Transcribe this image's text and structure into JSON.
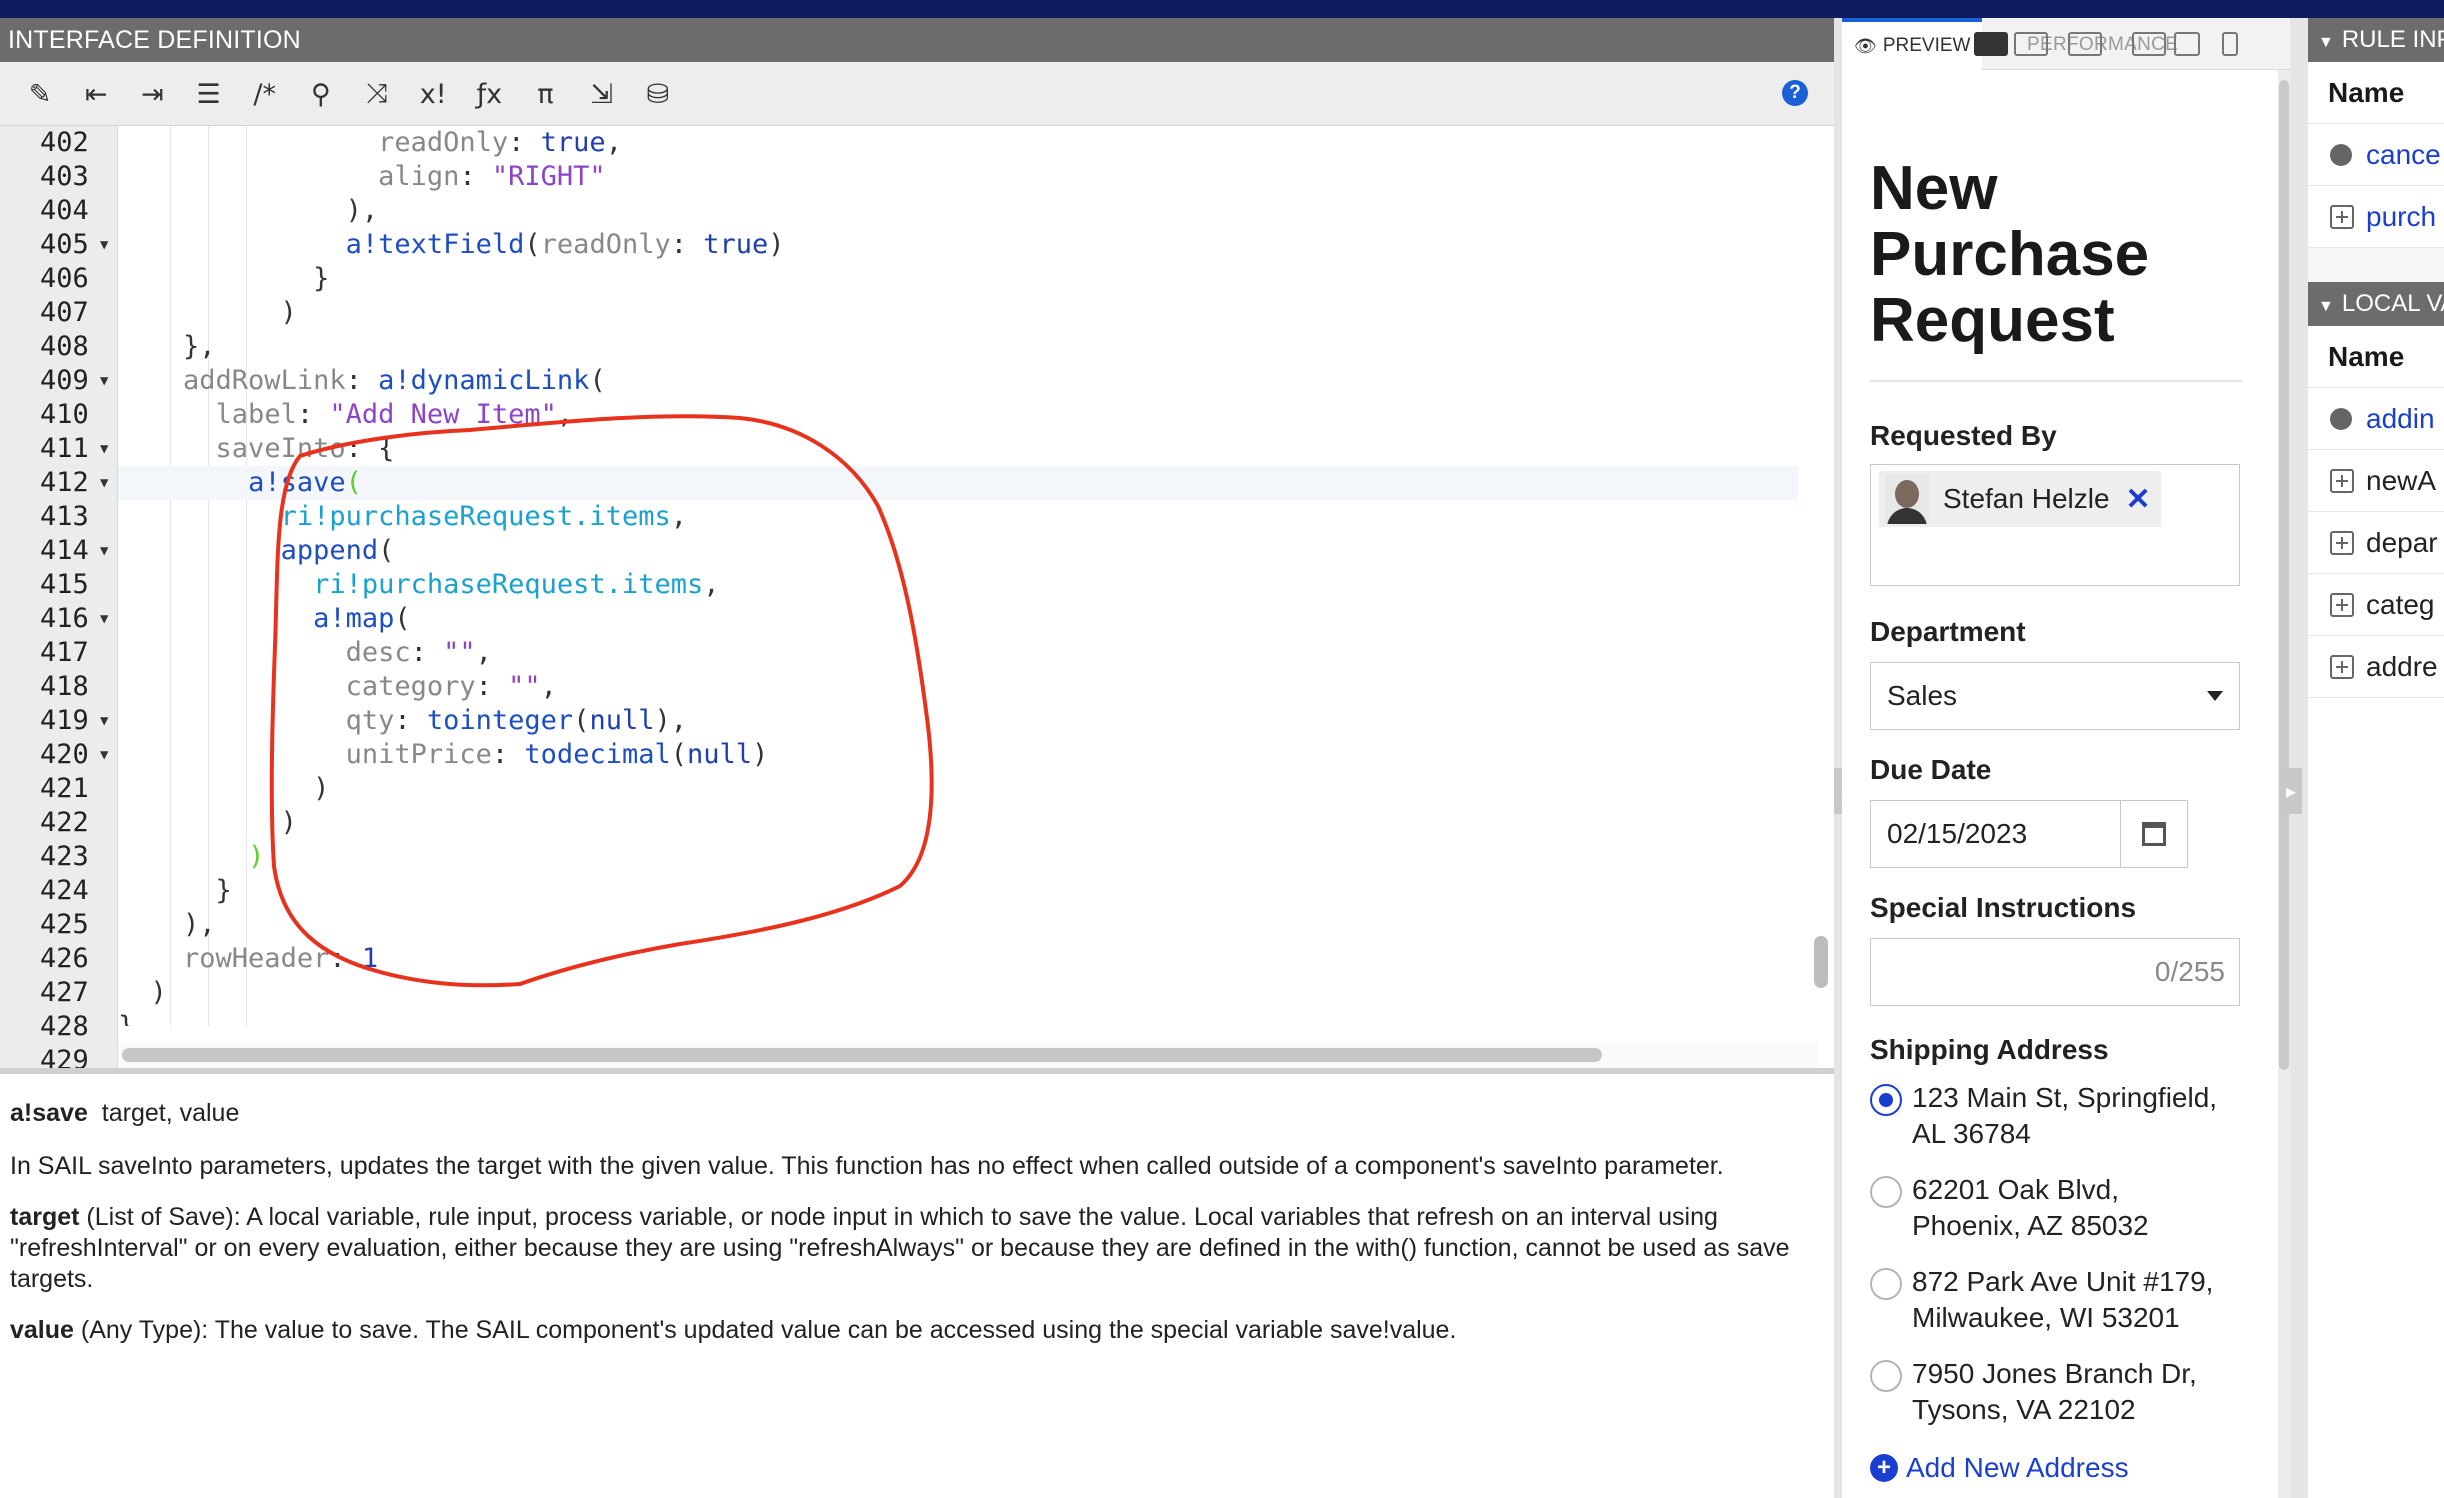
{
  "editor": {
    "title": "INTERFACE DEFINITION",
    "line_numbers": [
      "402",
      "403",
      "404",
      "405",
      "406",
      "407",
      "408",
      "409",
      "410",
      "411",
      "412",
      "413",
      "414",
      "415",
      "416",
      "417",
      "418",
      "419",
      "420",
      "421",
      "422",
      "423",
      "424",
      "425",
      "426",
      "427",
      "428",
      "429"
    ],
    "folded_lines": [
      "405",
      "409",
      "411",
      "412",
      "414",
      "416",
      "419",
      "420"
    ],
    "code_lines": [
      [
        {
          "t": "        "
        },
        {
          "t": "readOnly",
          "c": "k"
        },
        {
          "t": ": "
        },
        {
          "t": "true",
          "c": "v"
        },
        {
          "t": ","
        }
      ],
      [
        {
          "t": "        "
        },
        {
          "t": "align",
          "c": "k"
        },
        {
          "t": ": "
        },
        {
          "t": "\"RIGHT\"",
          "c": "s"
        }
      ],
      [
        {
          "t": "      ),"
        }
      ],
      [
        {
          "t": "      "
        },
        {
          "t": "a!textField",
          "c": "f"
        },
        {
          "t": "("
        },
        {
          "t": "readOnly",
          "c": "k"
        },
        {
          "t": ": "
        },
        {
          "t": "true",
          "c": "v"
        },
        {
          "t": ")"
        }
      ],
      [
        {
          "t": "    }"
        }
      ],
      [
        {
          "t": "  )"
        }
      ],
      [
        {
          "t": "},"
        }
      ],
      [
        {
          "t": "addRowLink",
          "c": "k"
        },
        {
          "t": ": "
        },
        {
          "t": "a!dynamicLink",
          "c": "f"
        },
        {
          "t": "("
        }
      ],
      [
        {
          "t": "  "
        },
        {
          "t": "label",
          "c": "k"
        },
        {
          "t": ": "
        },
        {
          "t": "\"Add New Item\"",
          "c": "s"
        },
        {
          "t": ","
        }
      ],
      [
        {
          "t": "  "
        },
        {
          "t": "saveInto",
          "c": "k"
        },
        {
          "t": ": {"
        }
      ],
      [
        {
          "t": "    "
        },
        {
          "t": "a!save",
          "c": "f"
        },
        {
          "t": "(",
          "c": "br"
        }
      ],
      [
        {
          "t": "      "
        },
        {
          "t": "ri!purchaseRequest.items",
          "c": "ri"
        },
        {
          "t": ","
        }
      ],
      [
        {
          "t": "      "
        },
        {
          "t": "append",
          "c": "f"
        },
        {
          "t": "("
        }
      ],
      [
        {
          "t": "        "
        },
        {
          "t": "ri!purchaseRequest.items",
          "c": "ri"
        },
        {
          "t": ","
        }
      ],
      [
        {
          "t": "        "
        },
        {
          "t": "a!map",
          "c": "f"
        },
        {
          "t": "("
        }
      ],
      [
        {
          "t": "          "
        },
        {
          "t": "desc",
          "c": "k"
        },
        {
          "t": ": "
        },
        {
          "t": "\"\"",
          "c": "s"
        },
        {
          "t": ","
        }
      ],
      [
        {
          "t": "          "
        },
        {
          "t": "category",
          "c": "k"
        },
        {
          "t": ": "
        },
        {
          "t": "\"\"",
          "c": "s"
        },
        {
          "t": ","
        }
      ],
      [
        {
          "t": "          "
        },
        {
          "t": "qty",
          "c": "k"
        },
        {
          "t": ": "
        },
        {
          "t": "tointeger",
          "c": "f"
        },
        {
          "t": "("
        },
        {
          "t": "null",
          "c": "v"
        },
        {
          "t": "),"
        }
      ],
      [
        {
          "t": "          "
        },
        {
          "t": "unitPrice",
          "c": "k"
        },
        {
          "t": ": "
        },
        {
          "t": "todecimal",
          "c": "f"
        },
        {
          "t": "("
        },
        {
          "t": "null",
          "c": "v"
        },
        {
          "t": ")"
        }
      ],
      [
        {
          "t": "        )"
        }
      ],
      [
        {
          "t": "      )"
        }
      ],
      [
        {
          "t": "    "
        },
        {
          "t": ")",
          "c": "br"
        }
      ],
      [
        {
          "t": "  }"
        }
      ],
      [
        {
          "t": "),"
        }
      ],
      [
        {
          "t": "rowHeader",
          "c": "k"
        },
        {
          "t": ": "
        },
        {
          "t": "1",
          "c": "v"
        }
      ],
      [
        {
          "t": ")"
        }
      ],
      [
        {
          "t": "}"
        }
      ],
      [
        {
          "t": ""
        }
      ]
    ],
    "code_base_indent": [
      8,
      8,
      8,
      8,
      8,
      8,
      4,
      4,
      4,
      4,
      4,
      4,
      4,
      4,
      4,
      4,
      4,
      4,
      4,
      4,
      4,
      4,
      4,
      4,
      4,
      2,
      0,
      0
    ]
  },
  "toolbar": {
    "buttons": [
      {
        "name": "magic-wand-icon",
        "glyph": "✎"
      },
      {
        "name": "outdent-icon",
        "glyph": "⇤"
      },
      {
        "name": "indent-icon",
        "glyph": "⇥"
      },
      {
        "name": "list-icon",
        "glyph": "☰"
      },
      {
        "name": "comment-icon",
        "glyph": "/*"
      },
      {
        "name": "search-icon",
        "glyph": "⚲"
      },
      {
        "name": "shuffle-icon",
        "glyph": "⤨"
      },
      {
        "name": "local-variable-icon",
        "glyph": "x!"
      },
      {
        "name": "function-icon",
        "glyph": "ƒx"
      },
      {
        "name": "pi-icon",
        "glyph": "π"
      },
      {
        "name": "export-icon",
        "glyph": "⇲"
      },
      {
        "name": "database-search-icon",
        "glyph": "⛁"
      }
    ],
    "help_glyph": "?"
  },
  "doc": {
    "fn_name": "a!save",
    "fn_params": "target, value",
    "description": "In SAIL saveInto parameters, updates the target with the given value. This function has no effect when called outside of a component's saveInto parameter.",
    "target_name": "target",
    "target_desc": " (List of Save): A local variable, rule input, process variable, or node input in which to save the value. Local variables that refresh on an interval using \"refreshInterval\" or on every evaluation, either because they are using \"refreshAlways\" or because they are defined in the with() function, cannot be used as save targets.",
    "value_name": "value",
    "value_desc": " (Any Type): The value to save. The SAIL component's updated value can be accessed using the special variable save!value."
  },
  "preview": {
    "tab_label": "PREVIEW",
    "performance_label": "PERFORMANCE",
    "title": "New Purchase Request",
    "requested_by_label": "Requested By",
    "requested_by_user": "Stefan Helzle",
    "remove_glyph": "✕",
    "department_label": "Department",
    "department_value": "Sales",
    "due_date_label": "Due Date",
    "due_date_value": "02/15/2023",
    "special_label": "Special Instructions",
    "special_counter": "0/255",
    "shipping_label": "Shipping Address",
    "addresses": [
      {
        "line1": "123 Main St, Springfield,",
        "line2": "AL 36784",
        "selected": true
      },
      {
        "line1": "62201 Oak Blvd,",
        "line2": "Phoenix, AZ 85032",
        "selected": false
      },
      {
        "line1": "872 Park Ave Unit #179,",
        "line2": "Milwaukee, WI 53201",
        "selected": false
      },
      {
        "line1": "7950 Jones Branch Dr,",
        "line2": "Tysons, VA 22102",
        "selected": false
      }
    ],
    "add_address_label": "Add New Address"
  },
  "right_panel": {
    "rule_inputs_header": "RULE INP",
    "col_name": "Name",
    "rule_inputs": [
      {
        "label": "cance",
        "kind": "dot"
      },
      {
        "label": "purch",
        "kind": "plus"
      }
    ],
    "local_vars_header": "LOCAL VA",
    "local_vars": [
      {
        "label": "addin",
        "kind": "dot"
      },
      {
        "label": "newA",
        "kind": "plus"
      },
      {
        "label": "depar",
        "kind": "plus"
      },
      {
        "label": "categ",
        "kind": "plus"
      },
      {
        "label": "addre",
        "kind": "plus"
      }
    ]
  },
  "colors": {
    "top_bar": "#0f1d5e",
    "accent_blue": "#1a3fd0",
    "annotation_red": "#e8321e"
  }
}
